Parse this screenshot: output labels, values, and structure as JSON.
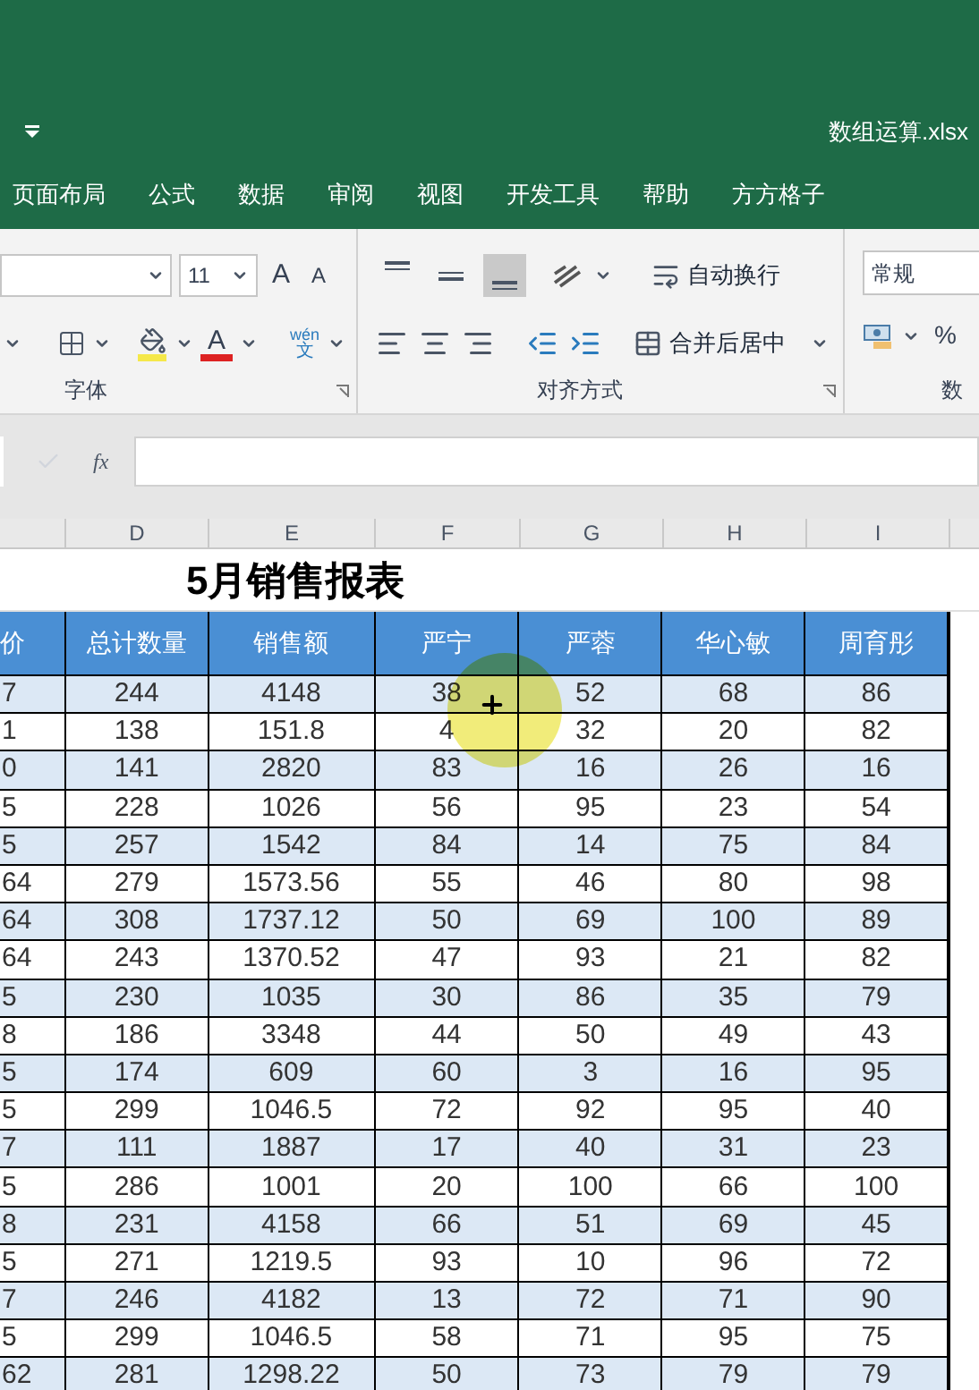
{
  "window": {
    "title": "数组运算.xlsx"
  },
  "ribbon_tabs": [
    {
      "label": "页面布局",
      "selected": false
    },
    {
      "label": "公式",
      "selected": false
    },
    {
      "label": "数据",
      "selected": false
    },
    {
      "label": "审阅",
      "selected": false
    },
    {
      "label": "视图",
      "selected": false
    },
    {
      "label": "开发工具",
      "selected": false
    },
    {
      "label": "帮助",
      "selected": false
    },
    {
      "label": "方方格子",
      "selected": false
    }
  ],
  "ribbon": {
    "font_size": "11",
    "grow_font": "A",
    "shrink_font": "A",
    "font_color": "A",
    "phonetic_top": "wén",
    "phonetic_bottom": "文",
    "vertical_align": [
      {
        "selected": false
      },
      {
        "selected": false
      },
      {
        "selected": true
      }
    ],
    "wrap_text": "自动换行",
    "merge_center": "合并后居中",
    "number_format": "常规",
    "percent": "%",
    "groups": [
      "字体",
      "对齐方式",
      "数"
    ]
  },
  "formula_bar": {
    "function_label": "fx"
  },
  "sheet": {
    "columns": [
      "",
      "D",
      "E",
      "F",
      "G",
      "H",
      "I"
    ],
    "title": "5月销售报表",
    "headers": [
      "价",
      "总计数量",
      "销售额",
      "严宁",
      "严蓉",
      "华心敏",
      "周育彤"
    ],
    "rows": [
      [
        "7",
        "244",
        "4148",
        "38",
        "52",
        "68",
        "86"
      ],
      [
        "1",
        "138",
        "151.8",
        "4",
        "32",
        "20",
        "82"
      ],
      [
        "0",
        "141",
        "2820",
        "83",
        "16",
        "26",
        "16"
      ],
      [
        "5",
        "228",
        "1026",
        "56",
        "95",
        "23",
        "54"
      ],
      [
        "5",
        "257",
        "1542",
        "84",
        "14",
        "75",
        "84"
      ],
      [
        "64",
        "279",
        "1573.56",
        "55",
        "46",
        "80",
        "98"
      ],
      [
        "64",
        "308",
        "1737.12",
        "50",
        "69",
        "100",
        "89"
      ],
      [
        "64",
        "243",
        "1370.52",
        "47",
        "93",
        "21",
        "82"
      ],
      [
        "5",
        "230",
        "1035",
        "30",
        "86",
        "35",
        "79"
      ],
      [
        "8",
        "186",
        "3348",
        "44",
        "50",
        "49",
        "43"
      ],
      [
        "5",
        "174",
        "609",
        "60",
        "3",
        "16",
        "95"
      ],
      [
        "5",
        "299",
        "1046.5",
        "72",
        "92",
        "95",
        "40"
      ],
      [
        "7",
        "111",
        "1887",
        "17",
        "40",
        "31",
        "23"
      ],
      [
        "5",
        "286",
        "1001",
        "20",
        "100",
        "66",
        "100"
      ],
      [
        "8",
        "231",
        "4158",
        "66",
        "51",
        "69",
        "45"
      ],
      [
        "5",
        "271",
        "1219.5",
        "93",
        "10",
        "96",
        "72"
      ],
      [
        "7",
        "246",
        "4182",
        "13",
        "72",
        "71",
        "90"
      ],
      [
        "5",
        "299",
        "1046.5",
        "58",
        "71",
        "95",
        "75"
      ],
      [
        "62",
        "281",
        "1298.22",
        "50",
        "73",
        "79",
        "79"
      ]
    ]
  }
}
